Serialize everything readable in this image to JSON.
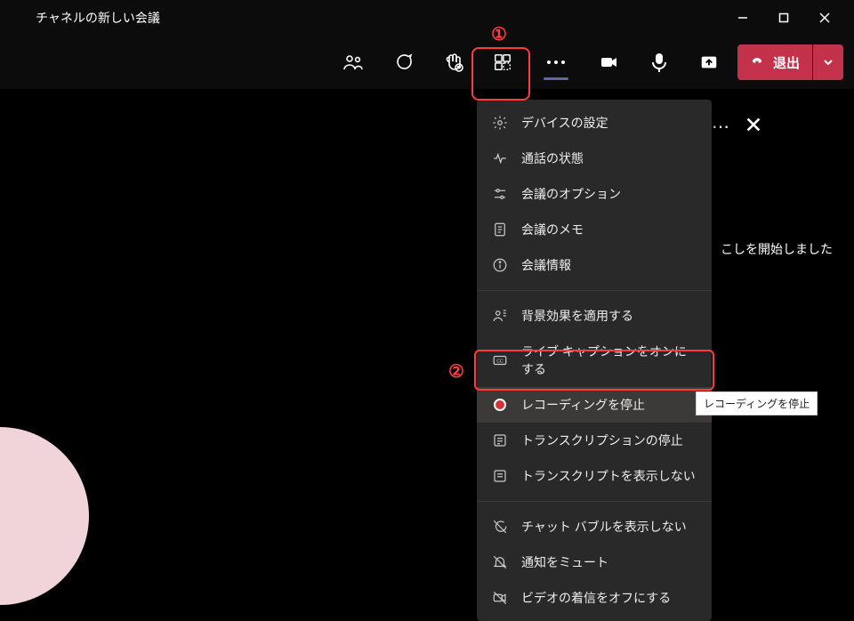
{
  "window": {
    "title": "チャネルの新しい会議"
  },
  "toolbar": {
    "leave_label": "退出"
  },
  "annotations": {
    "one": "①",
    "two": "②"
  },
  "menu": {
    "device_settings": "デバイスの設定",
    "call_health": "通話の状態",
    "meeting_options": "会議のオプション",
    "meeting_notes": "会議のメモ",
    "meeting_info": "会議情報",
    "apply_bg": "背景効果を適用する",
    "live_captions_on": "ライブ キャプションをオンにする",
    "stop_recording": "レコーディングを停止",
    "stop_transcription": "トランスクリプションの停止",
    "hide_transcript": "トランスクリプトを表示しない",
    "hide_chat_bubble": "チャット バブルを表示しない",
    "mute_notifications": "通知をミュート",
    "turn_off_incoming_video": "ビデオの着信をオフにする"
  },
  "tooltip": {
    "stop_recording": "レコーディングを停止"
  },
  "status": {
    "line": "こしを開始しました"
  }
}
